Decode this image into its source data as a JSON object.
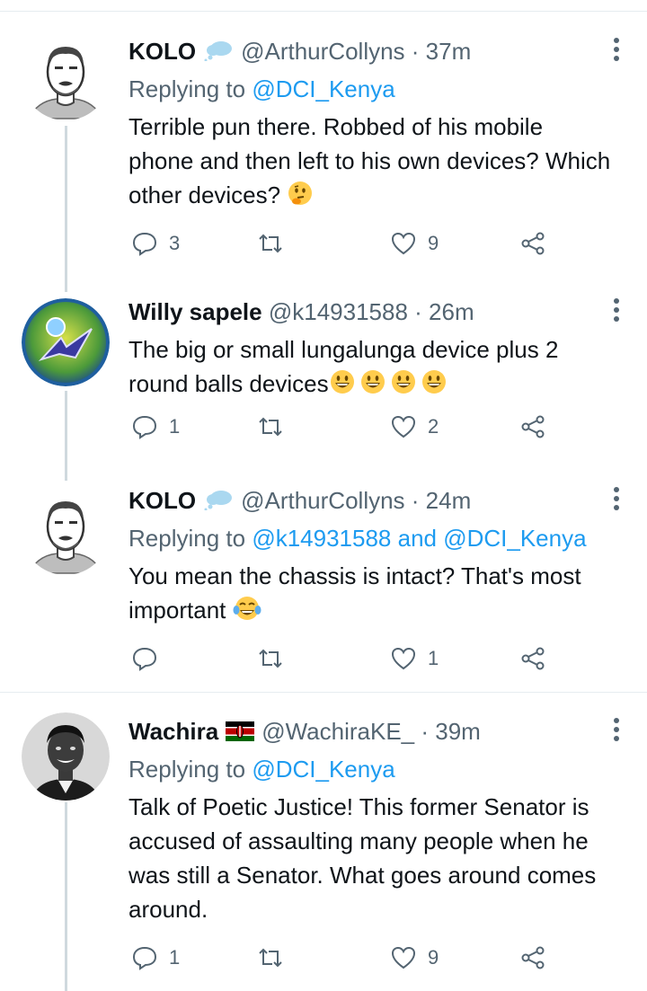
{
  "tweets": [
    {
      "name": "KOLO",
      "badge": "thought-bubble",
      "handle": "@ArthurCollyns",
      "time": "· 37m",
      "replying_prefix": "Replying to ",
      "replying_to": "@DCI_Kenya",
      "text": "Terrible pun there. Robbed of his mobile phone and then left to his own devices? Which other devices?",
      "emoji": "thinking-face",
      "reply_count": "3",
      "retweet_count": "",
      "like_count": "9"
    },
    {
      "name": "Willy sapele",
      "handle": "@k14931588",
      "time": "· 26m",
      "text": "The big or small lungalunga device plus 2 round balls devices",
      "emoji": "grinning-face x4",
      "reply_count": "1",
      "retweet_count": "",
      "like_count": "2"
    },
    {
      "name": "KOLO",
      "badge": "thought-bubble",
      "handle": "@ArthurCollyns",
      "time": "· 24m",
      "replying_prefix": "Replying to ",
      "replying_to": "@k14931588 and @DCI_Kenya",
      "text": "You mean the chassis is intact? That's most important",
      "emoji": "tears-of-joy",
      "reply_count": "",
      "retweet_count": "",
      "like_count": "1"
    },
    {
      "name": "Wachira",
      "badge": "kenya-flag",
      "handle": "@WachiraKE_",
      "time": "· 39m",
      "replying_prefix": "Replying to ",
      "replying_to": "@DCI_Kenya",
      "text": "Talk of Poetic Justice! This former Senator is accused of assaulting many people when he was still a Senator. What goes around comes around.",
      "reply_count": "1",
      "retweet_count": "",
      "like_count": "9"
    }
  ],
  "colors": {
    "mention": "#1d9bf0",
    "secondary": "#536471",
    "line": "#cfd9de"
  }
}
